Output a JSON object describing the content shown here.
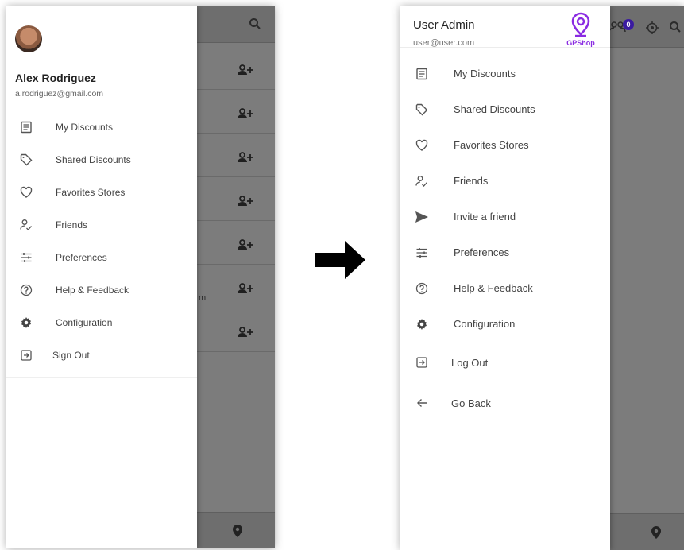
{
  "left_screen": {
    "user": {
      "name": "Alex Rodriguez",
      "email": "a.rodriguez@gmail.com"
    },
    "menu": [
      {
        "label": "My Discounts",
        "icon": "list-icon"
      },
      {
        "label": "Shared Discounts",
        "icon": "tag-icon"
      },
      {
        "label": "Favorites Stores",
        "icon": "heart-icon"
      },
      {
        "label": "Friends",
        "icon": "person-check-icon"
      },
      {
        "label": "Preferences",
        "icon": "sliders-icon"
      },
      {
        "label": "Help & Feedback",
        "icon": "help-icon"
      },
      {
        "label": "Configuration",
        "icon": "gear-icon"
      },
      {
        "label": "Sign Out",
        "icon": "sign-out-icon"
      }
    ],
    "background_text": "m"
  },
  "right_screen": {
    "user": {
      "name": "User Admin",
      "email": "user@user.com"
    },
    "logo_text": "GPShop",
    "badge_count": "0",
    "menu": [
      {
        "label": "My Discounts",
        "icon": "list-icon"
      },
      {
        "label": "Shared Discounts",
        "icon": "tag-icon"
      },
      {
        "label": "Favorites Stores",
        "icon": "heart-icon"
      },
      {
        "label": "Friends",
        "icon": "person-check-icon"
      },
      {
        "label": "Invite a friend",
        "icon": "send-icon"
      },
      {
        "label": "Preferences",
        "icon": "sliders-icon"
      },
      {
        "label": "Help & Feedback",
        "icon": "help-icon"
      },
      {
        "label": "Configuration",
        "icon": "gear-icon"
      },
      {
        "label": "Log Out",
        "icon": "sign-out-icon"
      },
      {
        "label": "Go Back",
        "icon": "arrow-back-icon"
      }
    ]
  },
  "colors": {
    "brand": "#8a2be2",
    "overlay": "#7c7c7c",
    "text": "#444444"
  }
}
